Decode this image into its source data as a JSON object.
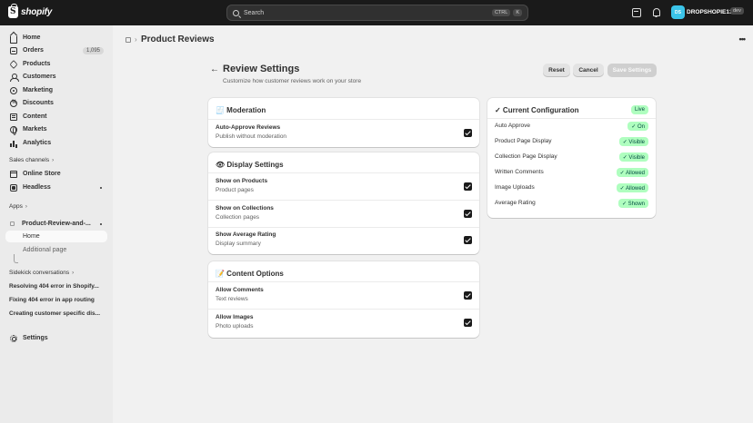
{
  "topbar": {
    "logo_text": "shopify",
    "search_placeholder": "Search",
    "shortcut_ctrl": "CTRL",
    "shortcut_key": "K",
    "avatar_initials": "DS",
    "store_name": "DROPSHOPIE13",
    "store_badge": "dev"
  },
  "sidebar": {
    "items": [
      {
        "label": "Home",
        "icon": "home-icon"
      },
      {
        "label": "Orders",
        "icon": "orders-icon",
        "count": "1,095"
      },
      {
        "label": "Products",
        "icon": "tag-icon"
      },
      {
        "label": "Customers",
        "icon": "person-icon"
      },
      {
        "label": "Marketing",
        "icon": "target-icon"
      },
      {
        "label": "Discounts",
        "icon": "discount-icon"
      },
      {
        "label": "Content",
        "icon": "content-icon"
      },
      {
        "label": "Markets",
        "icon": "globe-icon"
      },
      {
        "label": "Analytics",
        "icon": "analytics-icon"
      }
    ],
    "sales_channels_label": "Sales channels",
    "channels": [
      {
        "label": "Online Store",
        "icon": "store-icon"
      },
      {
        "label": "Headless",
        "icon": "headless-icon"
      }
    ],
    "apps_label": "Apps",
    "app_name": "Product-Review-and-...",
    "app_pages": [
      "Home",
      "Additional page"
    ],
    "sidekick_label": "Sidekick conversations",
    "conversations": [
      "Resolving 404 error in Shopify...",
      "Fixing 404 error in app routing",
      "Creating customer specific dis..."
    ],
    "settings_label": "Settings"
  },
  "page": {
    "title": "Product Reviews",
    "settings_title": "Review Settings",
    "settings_subtitle": "Customize how customer reviews work on your store",
    "buttons": {
      "reset": "Reset",
      "cancel": "Cancel",
      "save": "Save Settings"
    }
  },
  "moderation": {
    "title": "🧾 Moderation",
    "rows": [
      {
        "label": "Auto-Approve Reviews",
        "sub": "Publish without moderation",
        "checked": true
      }
    ]
  },
  "display": {
    "title": "👁 Display Settings",
    "rows": [
      {
        "label": "Show on Products",
        "sub": "Product pages",
        "checked": true
      },
      {
        "label": "Show on Collections",
        "sub": "Collection pages",
        "checked": true
      },
      {
        "label": "Show Average Rating",
        "sub": "Display summary",
        "checked": true
      }
    ]
  },
  "content_options": {
    "title": "📝 Content Options",
    "rows": [
      {
        "label": "Allow Comments",
        "sub": "Text reviews",
        "checked": true
      },
      {
        "label": "Allow Images",
        "sub": "Photo uploads",
        "checked": true
      }
    ]
  },
  "config": {
    "title": "✓ Current Configuration",
    "status": "Live",
    "rows": [
      {
        "label": "Auto Approve",
        "value": "✓ On"
      },
      {
        "label": "Product Page Display",
        "value": "✓ Visible"
      },
      {
        "label": "Collection Page Display",
        "value": "✓ Visible"
      },
      {
        "label": "Written Comments",
        "value": "✓ Allowed"
      },
      {
        "label": "Image Uploads",
        "value": "✓ Allowed"
      },
      {
        "label": "Average Rating",
        "value": "✓ Shown"
      }
    ]
  },
  "colors": {
    "topbar": "#1a1a1a",
    "sidebar": "#ebebeb",
    "background": "#f1f1f1",
    "success_pill": "#affebf",
    "success_text": "#014b40",
    "checkbox": "#1a1a1a"
  }
}
